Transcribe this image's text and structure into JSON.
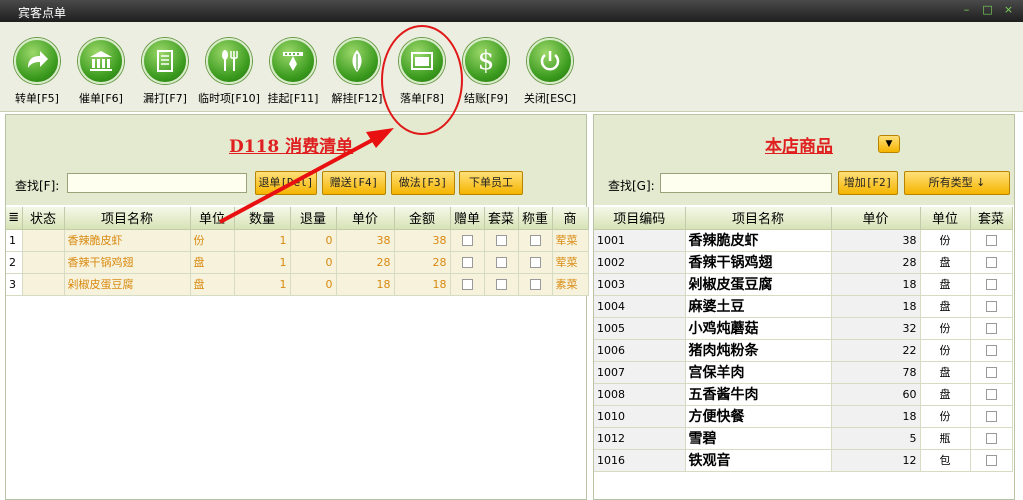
{
  "window": {
    "title": "宾客点单",
    "controls": [
      "–",
      "□",
      "×"
    ]
  },
  "toolbar": {
    "buttons": [
      {
        "label": "转单[F5]",
        "icon": "arrow-right-icon"
      },
      {
        "label": "催单[F6]",
        "icon": "bank-icon"
      },
      {
        "label": "漏打[F7]",
        "icon": "document-icon"
      },
      {
        "label": "临时项[F10]",
        "icon": "spoon-fork-icon"
      },
      {
        "label": "挂起[F11]",
        "icon": "hang-icon"
      },
      {
        "label": "解挂[F12]",
        "icon": "leaf-icon"
      },
      {
        "label": "落单[F8]",
        "icon": "window-icon"
      },
      {
        "label": "结账[F9]",
        "icon": "dollar-icon"
      },
      {
        "label": "关闭[ESC]",
        "icon": "power-icon"
      }
    ]
  },
  "order": {
    "title": "D118  消费清单",
    "search_label": "查找[F]:",
    "search_value": "",
    "buttons": {
      "return": "退单[Del]",
      "gift": "赠送[F4]",
      "method": "做法[F3]",
      "staff": "下单员工"
    },
    "columns": [
      "≣",
      "状态",
      "项目名称",
      "单位",
      "数量",
      "退量",
      "单价",
      "金额",
      "赠单",
      "套菜",
      "称重",
      "商"
    ],
    "rows": [
      {
        "idx": "1",
        "status": "",
        "name": "香辣脆皮虾",
        "unit": "份",
        "qty": "1",
        "ret": "0",
        "price": "38",
        "amount": "38",
        "tail": "荤菜"
      },
      {
        "idx": "2",
        "status": "",
        "name": "香辣干锅鸡翅",
        "unit": "盘",
        "qty": "1",
        "ret": "0",
        "price": "28",
        "amount": "28",
        "tail": "荤菜"
      },
      {
        "idx": "3",
        "status": "",
        "name": "剁椒皮蛋豆腐",
        "unit": "盘",
        "qty": "1",
        "ret": "0",
        "price": "18",
        "amount": "18",
        "tail": "素菜"
      }
    ]
  },
  "menu": {
    "title": "本店商品",
    "search_label": "查找[G]:",
    "search_value": "",
    "buttons": {
      "add": "增加[F2]",
      "types": "所有类型 ↓"
    },
    "columns": [
      "项目编码",
      "项目名称",
      "单价",
      "单位",
      "套菜"
    ],
    "rows": [
      {
        "code": "1001",
        "name": "香辣脆皮虾",
        "price": "38",
        "unit": "份"
      },
      {
        "code": "1002",
        "name": "香辣干锅鸡翅",
        "price": "28",
        "unit": "盘"
      },
      {
        "code": "1003",
        "name": "剁椒皮蛋豆腐",
        "price": "18",
        "unit": "盘"
      },
      {
        "code": "1004",
        "name": "麻婆土豆",
        "price": "18",
        "unit": "盘"
      },
      {
        "code": "1005",
        "name": "小鸡炖蘑菇",
        "price": "32",
        "unit": "份"
      },
      {
        "code": "1006",
        "name": "猪肉炖粉条",
        "price": "22",
        "unit": "份"
      },
      {
        "code": "1007",
        "name": "宫保羊肉",
        "price": "78",
        "unit": "盘"
      },
      {
        "code": "1008",
        "name": "五香酱牛肉",
        "price": "60",
        "unit": "盘"
      },
      {
        "code": "1010",
        "name": "方便快餐",
        "price": "18",
        "unit": "份"
      },
      {
        "code": "1012",
        "name": "雪碧",
        "price": "5",
        "unit": "瓶"
      },
      {
        "code": "1016",
        "name": "铁观音",
        "price": "12",
        "unit": "包"
      }
    ]
  },
  "colors": {
    "accent": "#e02020",
    "button": "#f5b400",
    "toolbar_icon": "#3a9a1e"
  }
}
